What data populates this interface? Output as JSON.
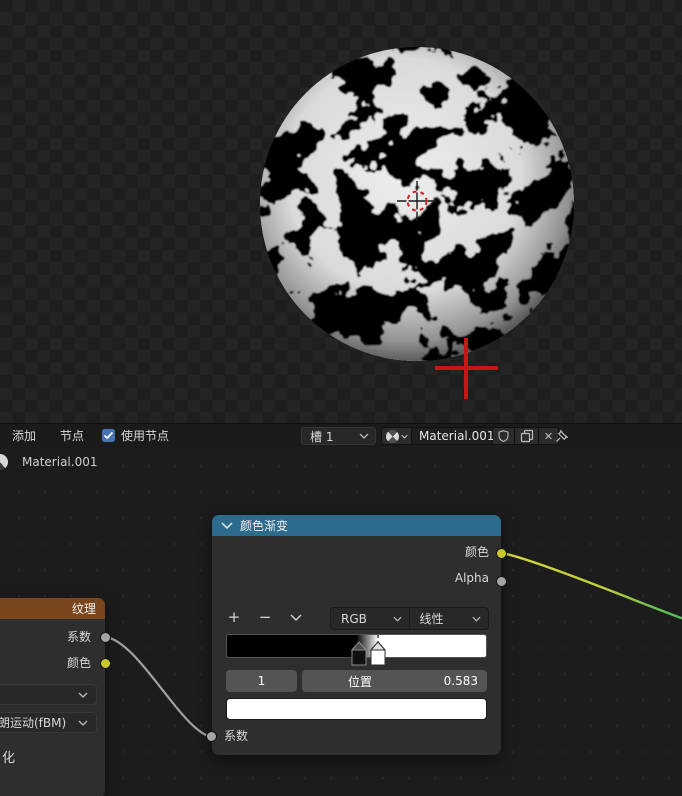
{
  "topbar": {
    "menu_add": "添加",
    "menu_node": "节点",
    "use_nodes_label": "使用节点",
    "use_nodes_checked": true,
    "slot_label": "槽 1",
    "material_name": "Material.001",
    "unlink_icon": "✕"
  },
  "breadcrumb": {
    "material": "Material.001"
  },
  "color_ramp_node": {
    "title": "颜色渐变",
    "output_color_label": "颜色",
    "output_alpha_label": "Alpha",
    "btn_add": "+",
    "btn_remove": "−",
    "color_mode": "RGB",
    "interpolation": "线性",
    "index_value": "1",
    "position_label": "位置",
    "position_value": "0.583",
    "input_fac_label": "系数",
    "swatch_color": "#ffffff",
    "stops": [
      {
        "position": 0.5,
        "color": "#000000"
      },
      {
        "position": 0.583,
        "color": "#ffffff",
        "active": true
      }
    ]
  },
  "texture_node": {
    "title_visible": "纹理",
    "output_fac_label": "系数",
    "output_color_label": "颜色",
    "noise_type_visible": "朗运动(fBM)",
    "bottom_label_visible": "化"
  },
  "viewport": {
    "content": "textured-sphere",
    "background": "transparent-checker"
  },
  "colors": {
    "colorramp_header": "#2c6b8c",
    "texture_header": "#7a461d",
    "socket_yellow": "#c9c92e",
    "socket_gray": "#a5a5a5",
    "checkbox_blue": "#4772b3",
    "noodle_gray": "#9f9f9f",
    "noodle_yellow": "#d7d63a",
    "noodle_green": "#52ba5e",
    "cursor_red": "#c81616"
  }
}
